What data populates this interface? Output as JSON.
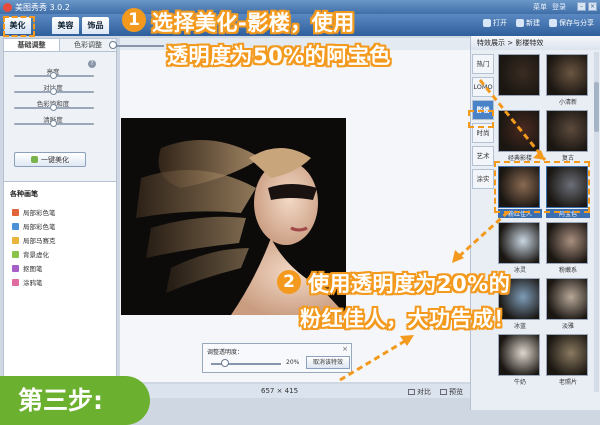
{
  "window": {
    "title": "美图秀秀 3.0.2",
    "links": [
      "菜单",
      "登录"
    ]
  },
  "toolbar": {
    "tabs": [
      "美化",
      "美容",
      "饰品"
    ],
    "open_label": "打开",
    "new_label": "新建",
    "save_label": "保存与分享"
  },
  "left_panel": {
    "tabs": [
      "基础调整",
      "色彩调整"
    ],
    "sliders": [
      {
        "label": "亮度",
        "value": 0.5
      },
      {
        "label": "对比度",
        "value": 0.5
      },
      {
        "label": "色彩饱和度",
        "value": 0.5
      },
      {
        "label": "清晰度",
        "value": 0.5
      }
    ],
    "one_click_label": "一键美化",
    "brushes_title": "各种画笔",
    "brushes": [
      {
        "label": "局部彩色笔",
        "color": "#e0653a"
      },
      {
        "label": "局部彩色笔",
        "color": "#4b8fd6"
      },
      {
        "label": "局部马赛克",
        "color": "#e8b43a"
      },
      {
        "label": "背景虚化",
        "color": "#8bc24a"
      },
      {
        "label": "抠图笔",
        "color": "#a55fc7"
      },
      {
        "label": "涂鸦笔",
        "color": "#e06ba0"
      }
    ]
  },
  "canvas": {
    "image_size": "657 × 415",
    "compare_label": "对比",
    "preview_label": "预览"
  },
  "opacity_popup": {
    "title": "调整透明度：",
    "value_text": "20%",
    "value": 0.2,
    "cancel_label": "取消该特效"
  },
  "effects_panel": {
    "header": "特效展示 > 影楼特效",
    "categories": [
      "热门",
      "LOMO",
      "影楼",
      "时尚",
      "艺术",
      "涂实"
    ],
    "active_category": "影楼",
    "thumbs": [
      "",
      "小清新",
      "经典影楼",
      "复古",
      "粉红佳人",
      "阿宝色",
      "冰灵",
      "粉嫩系",
      "冰蓝",
      "淡雅",
      "牛奶",
      "老照片"
    ]
  },
  "annotations": {
    "step1_number": "1",
    "step1_line1": "选择美化-影楼，使用",
    "step1_line2": "透明度为50%的阿宝色",
    "step2_number": "2",
    "step2_line1": "使用透明度为20%的",
    "step2_line2": "粉红佳人，大功告成！",
    "step_badge": "第三步:",
    "accent_color": "#f39a1e",
    "step_color": "#6cb02f"
  }
}
